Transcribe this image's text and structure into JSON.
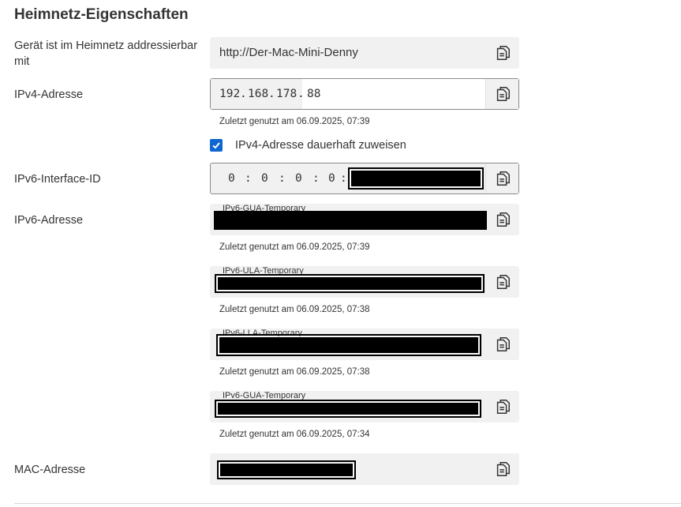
{
  "section": {
    "title": "Heimnetz-Eigenschaften"
  },
  "address": {
    "label": "Gerät ist im Heimnetz addressierbar mit",
    "value": "http://Der-Mac-Mini-Denny"
  },
  "ipv4": {
    "label": "IPv4-Adresse",
    "octets": [
      "192",
      "168",
      "178",
      "88"
    ],
    "dot": ".",
    "last_used": "Zuletzt genutzt am 06.09.2025, 07:39",
    "permanent_label": "IPv4-Adresse dauerhaft zuweisen",
    "permanent_checked": true
  },
  "ipv6_iid": {
    "label": "IPv6-Interface-ID",
    "parts": [
      "0",
      "0",
      "0",
      "0"
    ],
    "colon": ":"
  },
  "ipv6": {
    "label": "IPv6-Adresse",
    "entries": [
      {
        "tag": "IPv6-GUA-Temporary",
        "last_used": "Zuletzt genutzt am 06.09.2025, 07:39"
      },
      {
        "tag": "IPv6-ULA-Temporary",
        "last_used": "Zuletzt genutzt am 06.09.2025, 07:38"
      },
      {
        "tag": "IPv6-LLA-Temporary",
        "last_used": "Zuletzt genutzt am 06.09.2025, 07:38"
      },
      {
        "tag": "IPv6-GUA-Temporary",
        "last_used": "Zuletzt genutzt am 06.09.2025, 07:34"
      }
    ]
  },
  "mac": {
    "label": "MAC-Adresse"
  },
  "icons": {
    "copy": "copy-icon",
    "check": "checkmark-icon"
  },
  "colors": {
    "accent": "#0f66d0",
    "field_bg": "#f1f1f1",
    "redaction": "#000000"
  }
}
